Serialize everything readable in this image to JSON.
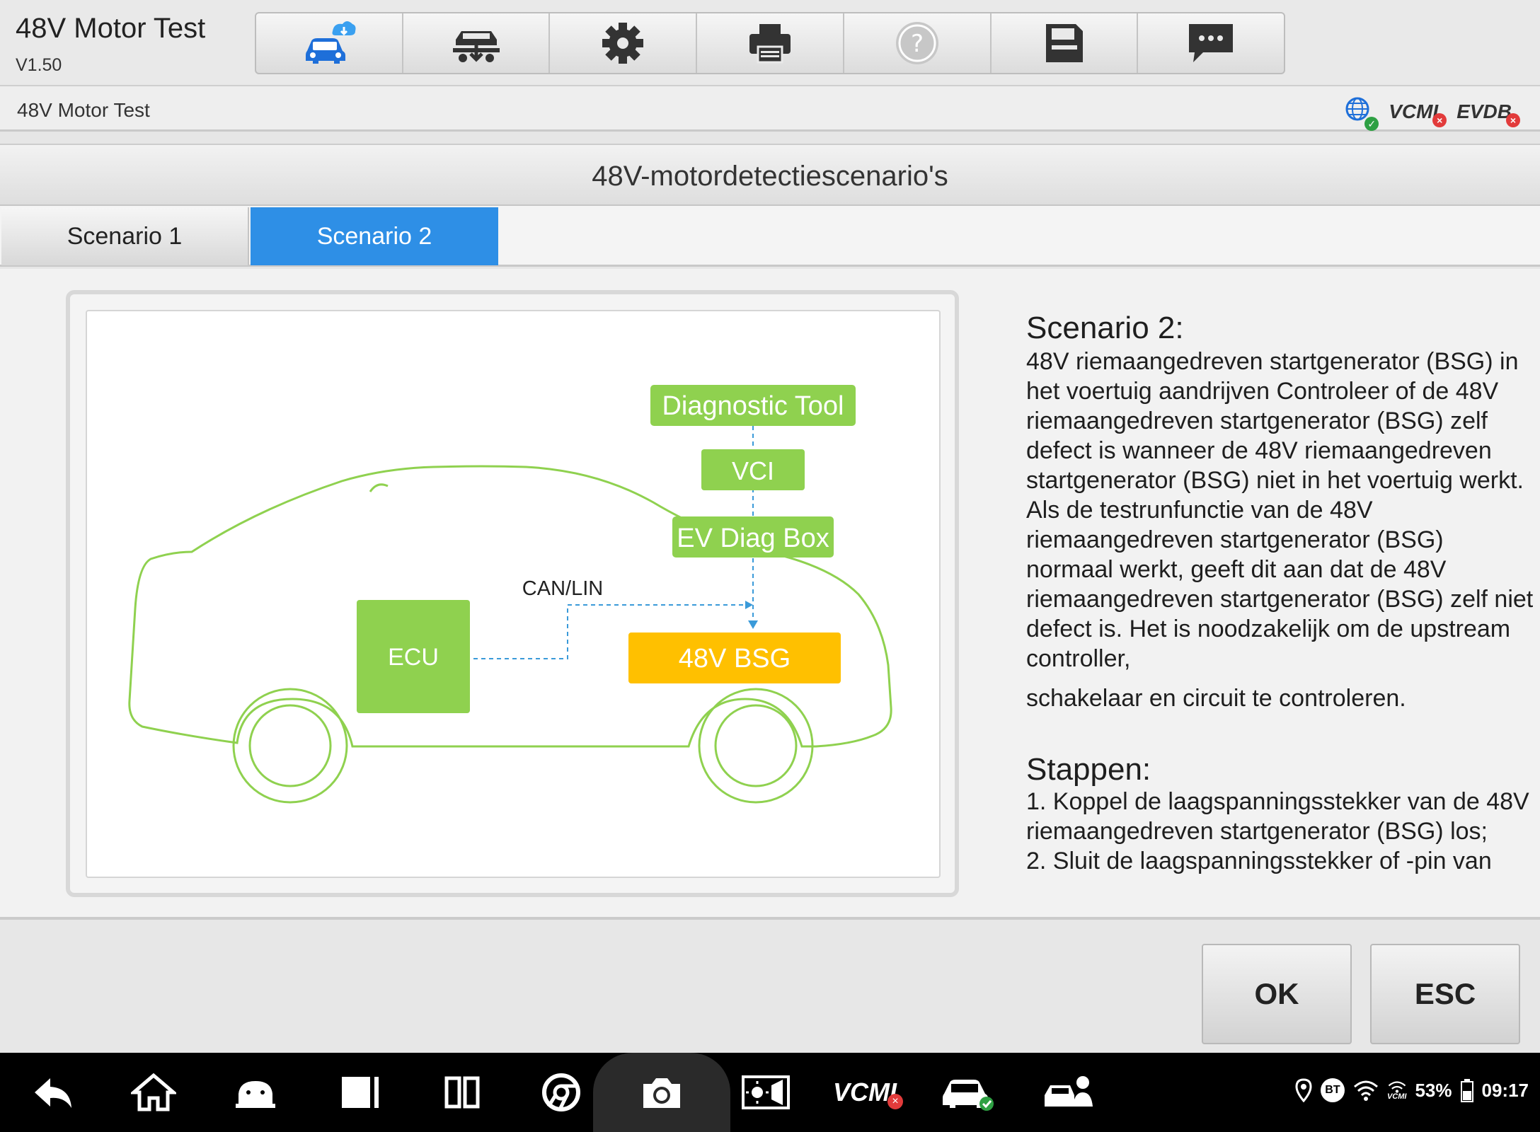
{
  "header": {
    "title": "48V Motor Test",
    "version": "V1.50"
  },
  "toolbar": {
    "items": [
      "vehicle-cloud-icon",
      "vehicle-lift-icon",
      "settings-gear-icon",
      "printer-icon",
      "help-icon",
      "save-icon",
      "message-icon"
    ]
  },
  "breadcrumb": {
    "path": "48V Motor Test"
  },
  "status": {
    "vcm_label": "VCMI",
    "evdb_label": "EVDB"
  },
  "section": {
    "title": "48V-motordetectiescenario's"
  },
  "tabs": [
    {
      "label": "Scenario 1",
      "active": false
    },
    {
      "label": "Scenario 2",
      "active": true
    }
  ],
  "diagram": {
    "diagnostic_tool": "Diagnostic Tool",
    "vci": "VCI",
    "ev_diag_box": "EV Diag Box",
    "can_lin": "CAN/LIN",
    "ecu": "ECU",
    "bsg": "48V BSG",
    "colors": {
      "green_box": "#8fd14f",
      "orange_box": "#ffc000",
      "outline_green": "#8fd14f",
      "dashed_blue": "#3a9ad9"
    }
  },
  "description": {
    "heading": "Scenario 2:",
    "body": "48V riemaangedreven startgenerator (BSG) in het voertuig aandrijven Controleer of de 48V riemaangedreven startgenerator (BSG) zelf defect is wanneer de 48V riemaangedreven startgenerator (BSG) niet in het voertuig werkt. Als de testrunfunctie van de 48V riemaangedreven startgenerator (BSG) normaal werkt, geeft dit aan dat de 48V riemaangedreven startgenerator (BSG) zelf niet defect is. Het is noodzakelijk om de upstream controller,",
    "body_tail": "schakelaar en circuit te controleren.",
    "steps_heading": "Stappen:",
    "step1": "1. Koppel de laagspanningsstekker van de 48V riemaangedreven startgenerator (BSG) los;",
    "step2": "2. Sluit de laagspanningsstekker of -pin van"
  },
  "actions": {
    "ok": "OK",
    "esc": "ESC"
  },
  "navbar": {
    "vcmi_label": "VCMI",
    "battery": "53%",
    "time": "09:17",
    "bt": "BT",
    "vcmi_small": "VCMI"
  }
}
